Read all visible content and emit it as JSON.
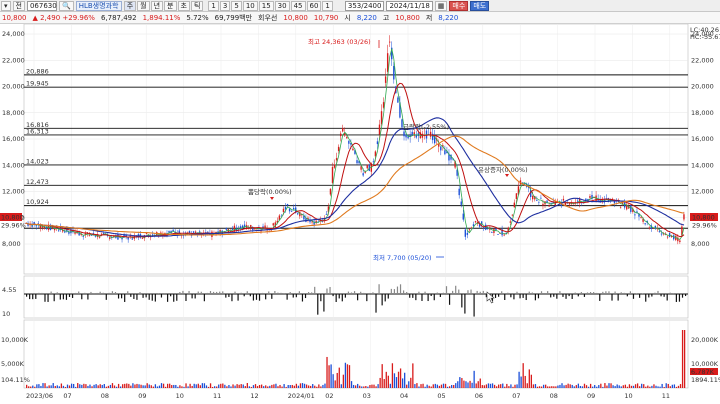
{
  "toolbar": {
    "dropdown_glyph": "▾",
    "market_label": "전",
    "code": "067630",
    "search_icon": "magnifier-icon",
    "stock_name": "HLB생명과학",
    "periods": [
      "주",
      "월",
      "년",
      "분",
      "초",
      "틱"
    ],
    "intervals": [
      "1",
      "3",
      "5",
      "10",
      "15",
      "30",
      "45",
      "60",
      "1"
    ],
    "count": "353/2400",
    "date": "2024/11/18",
    "buy_label": "매수",
    "sell_label": "매도"
  },
  "quote": {
    "price": "10,800",
    "change": "▲ 2,490 +29.96%",
    "volume": "6,787,492",
    "volume_ratio": "1,894.11%",
    "turnover_ratio": "5.72%",
    "amount": "69,799백만",
    "type": "회우선",
    "open": "10,800",
    "open2": "10,790",
    "high_label": "시",
    "high": "8,220",
    "low_label": "고",
    "low": "10,800",
    "low2_label": "저",
    "low2": "8,220"
  },
  "price_axis": {
    "ticks": [
      "24,000",
      "22,000",
      "20,000",
      "18,000",
      "16,000",
      "14,000",
      "12,000",
      "10,000",
      "8,000"
    ],
    "corner_label": "LC:40.26",
    "corner_label2": "HC:-55.67"
  },
  "levels": [
    {
      "label": "20,886"
    },
    {
      "label": "19,945"
    },
    {
      "label": "16,816"
    },
    {
      "label": "16,313"
    },
    {
      "label": "14,023"
    },
    {
      "label": "12,473"
    },
    {
      "label": "10,924"
    },
    {
      "label": "10,800"
    }
  ],
  "left_badges": {
    "price": "10,800",
    "pct": "29.96%"
  },
  "right_badges": {
    "price": "10,800",
    "pct": "29.96%"
  },
  "annotations": {
    "high": "최고 24,363 (03/26)",
    "low": "최저 7,700 (05/20)",
    "rise": "급락락(-2,55%)",
    "fall1": "뽐당락(0.00%)",
    "fall2": "유상증자(0.00%)"
  },
  "indicator_axis": {
    "left_top": "4.55",
    "left_bottom": "10"
  },
  "volume_axis": {
    "left_top": "10,000K",
    "left_mid": "5,000K",
    "right_top": "20,000K",
    "right_mid": "10,000K",
    "badge1": "6,787K",
    "badge2": "1894.11%",
    "left_badge": "104.11%"
  },
  "date_axis": [
    "2023/06",
    "07",
    "08",
    "09",
    "10",
    "11",
    "12",
    "2024/01",
    "02",
    "03",
    "04",
    "05",
    "06",
    "07",
    "08",
    "09",
    "10",
    "11"
  ],
  "colors": {
    "up": "#d81b1b",
    "down": "#1b4fd8",
    "ma_short": "#2fa84f",
    "ma_mid": "#c01010",
    "ma_long": "#1e2fa0",
    "ma_year": "#e07a1f"
  }
}
